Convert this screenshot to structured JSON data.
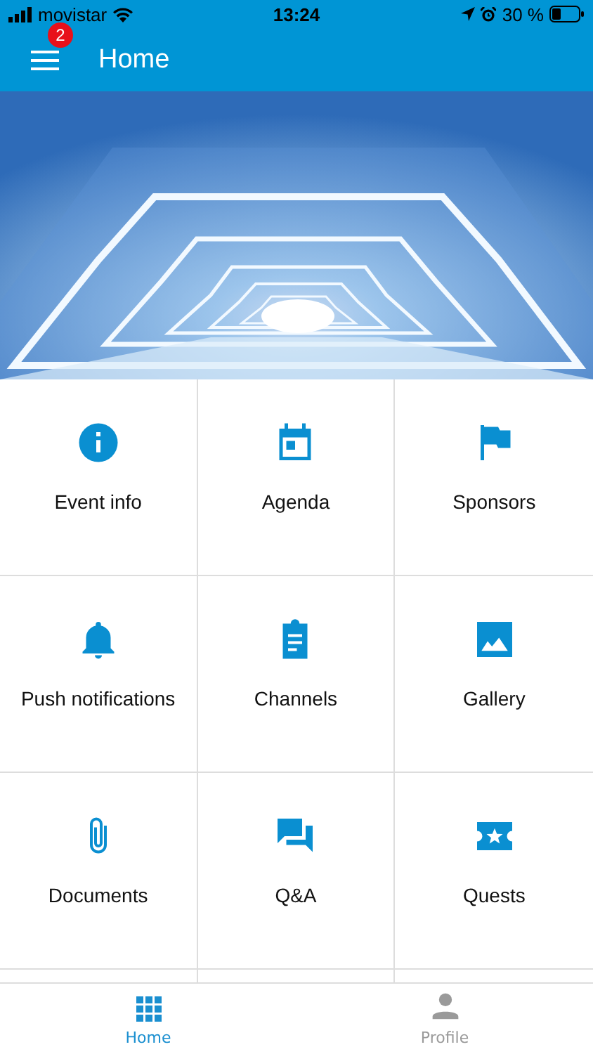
{
  "status_bar": {
    "carrier": "movistar",
    "time": "13:24",
    "battery": "30 %"
  },
  "header": {
    "title": "Home",
    "badge": "2"
  },
  "tiles": [
    {
      "label": "Event info"
    },
    {
      "label": "Agenda"
    },
    {
      "label": "Sponsors"
    },
    {
      "label": "Push notifications"
    },
    {
      "label": "Channels"
    },
    {
      "label": "Gallery"
    },
    {
      "label": "Documents"
    },
    {
      "label": "Q&A"
    },
    {
      "label": "Quests"
    }
  ],
  "nav": [
    {
      "label": "Home",
      "selected": true
    },
    {
      "label": "Profile",
      "selected": false
    }
  ]
}
